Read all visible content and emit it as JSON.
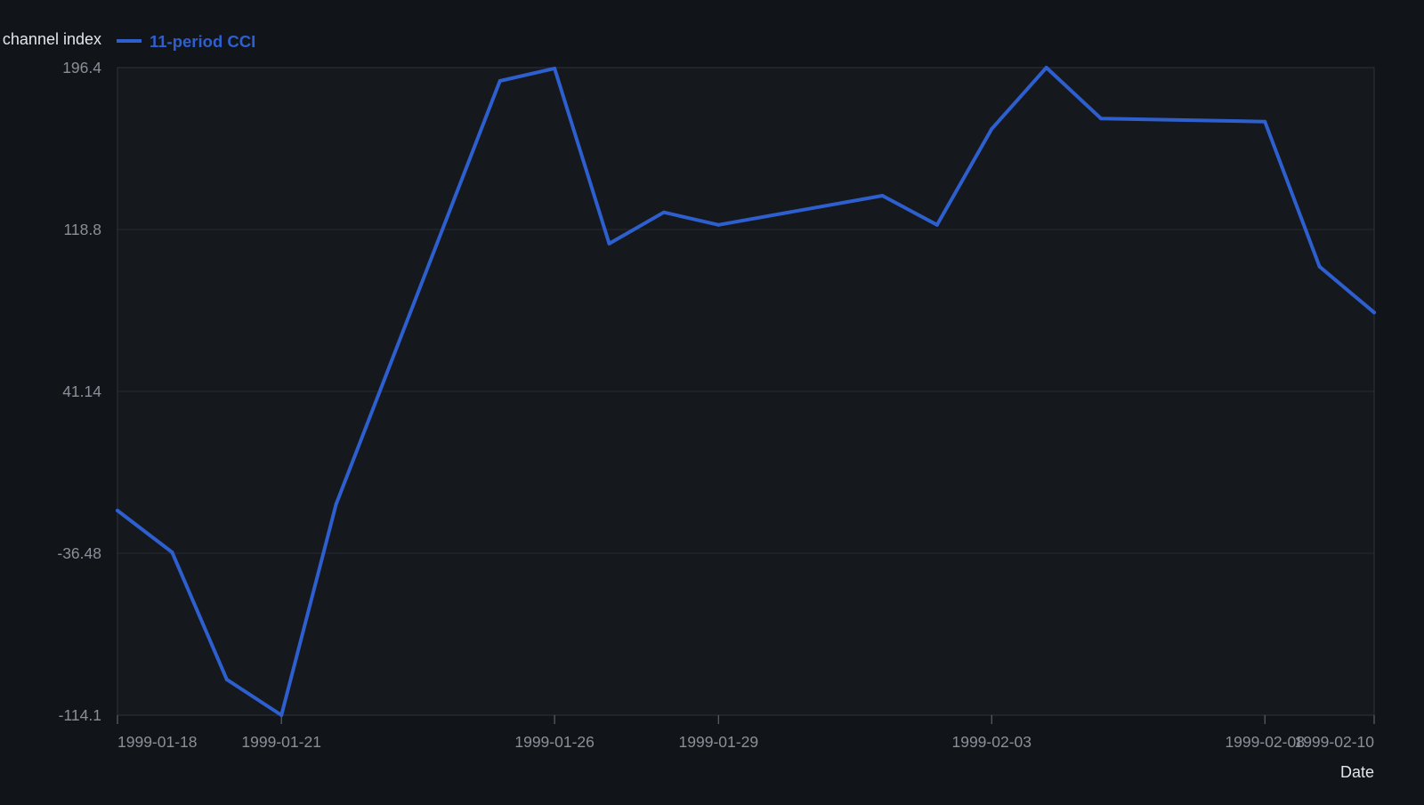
{
  "chart_data": {
    "type": "line",
    "ylabel": "Commodity channel index",
    "xlabel": "Date",
    "legend_position": "top-left",
    "grid": true,
    "colors": {
      "background": "#111419",
      "plot_background": "#15181d",
      "series": "#2e5fcf"
    },
    "ylim": [
      -114.1,
      196.4
    ],
    "yticks": [
      "196.4",
      "118.8",
      "41.14",
      "-36.48",
      "-114.1"
    ],
    "xticks": [
      "1999-01-18",
      "1999-01-21",
      "1999-01-26",
      "1999-01-29",
      "1999-02-03",
      "1999-02-08",
      "1999-02-10"
    ],
    "x_range": [
      "1999-01-18",
      "1999-02-10"
    ],
    "series": [
      {
        "name": "11-period CCI",
        "x": [
          "1999-01-18",
          "1999-01-19",
          "1999-01-20",
          "1999-01-21",
          "1999-01-22",
          "1999-01-25",
          "1999-01-26",
          "1999-01-27",
          "1999-01-28",
          "1999-01-29",
          "1999-02-01",
          "1999-02-02",
          "1999-02-03",
          "1999-02-04",
          "1999-02-05",
          "1999-02-08",
          "1999-02-09",
          "1999-02-10"
        ],
        "values": [
          -16,
          -36,
          -97,
          -114.1,
          -13,
          190,
          196,
          112,
          127,
          121,
          135,
          121,
          167,
          196.4,
          172,
          170.5,
          101,
          79
        ]
      }
    ]
  }
}
